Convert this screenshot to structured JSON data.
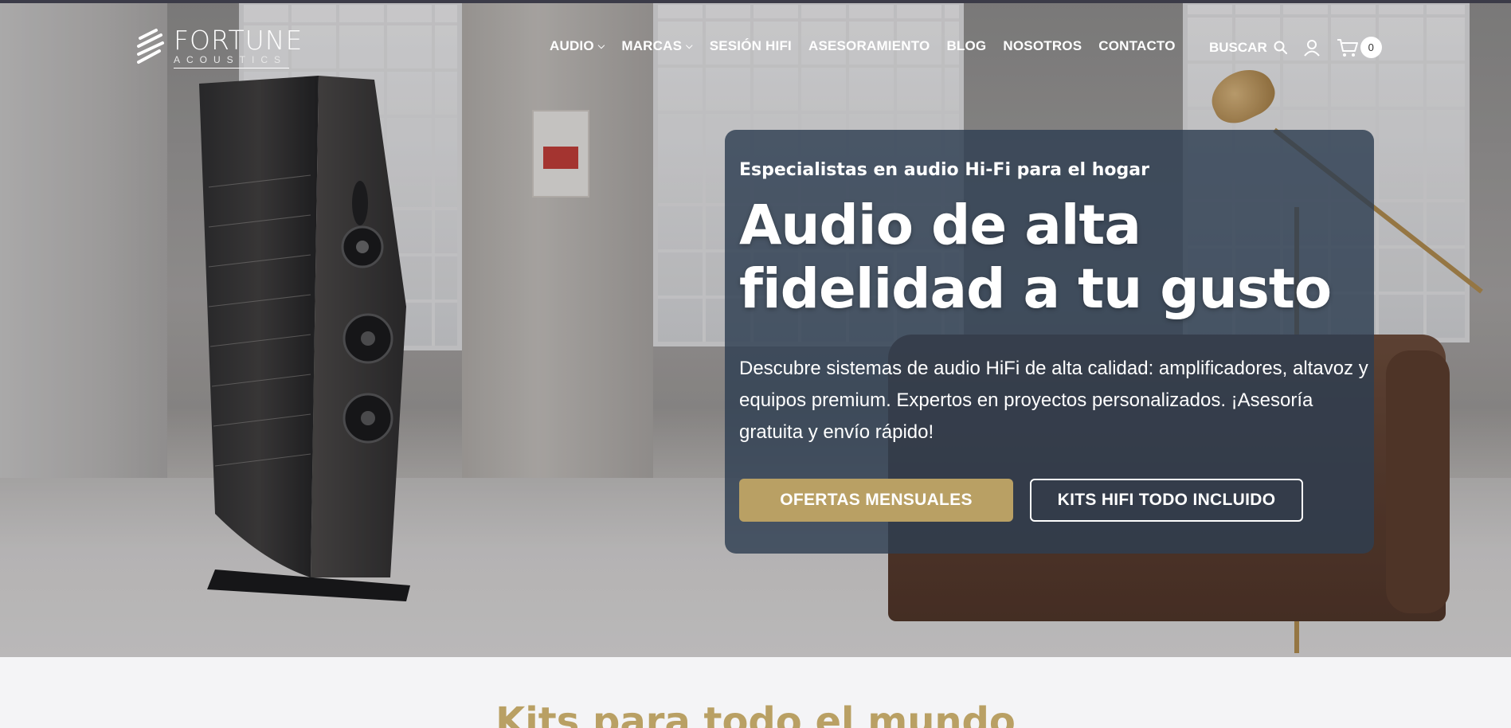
{
  "brand": {
    "name": "FORTUNE",
    "subtitle": "ACOUSTICS"
  },
  "nav": {
    "items": [
      {
        "label": "AUDIO",
        "dropdown": true
      },
      {
        "label": "MARCAS",
        "dropdown": true
      },
      {
        "label": "SESIÓN HIFI",
        "dropdown": false
      },
      {
        "label": "ASESORAMIENTO",
        "dropdown": false
      },
      {
        "label": "BLOG",
        "dropdown": false
      },
      {
        "label": "NOSOTROS",
        "dropdown": false
      },
      {
        "label": "CONTACTO",
        "dropdown": false
      }
    ],
    "search_label": "BUSCAR",
    "cart_count": "0"
  },
  "hero": {
    "eyebrow": "Especialistas en audio Hi-Fi para el hogar",
    "headline": "Audio de alta fidelidad a tu gusto",
    "description": "Descubre sistemas de audio HiFi de alta calidad: amplificadores, altavoz y equipos premium. Expertos en proyectos personalizados. ¡Asesoría gratuita y envío rápido!",
    "primary_cta": "OFERTAS MENSUALES",
    "secondary_cta": "KITS HIFI TODO INCLUIDO"
  },
  "section": {
    "title": "Kits para todo el mundo"
  },
  "colors": {
    "accent": "#b9a064",
    "card": "#2e3e52",
    "page_bg": "#f4f4f6"
  },
  "icons": {
    "search": "search-icon",
    "user": "user-icon",
    "cart": "cart-icon",
    "chevron": "chevron-down-icon"
  }
}
